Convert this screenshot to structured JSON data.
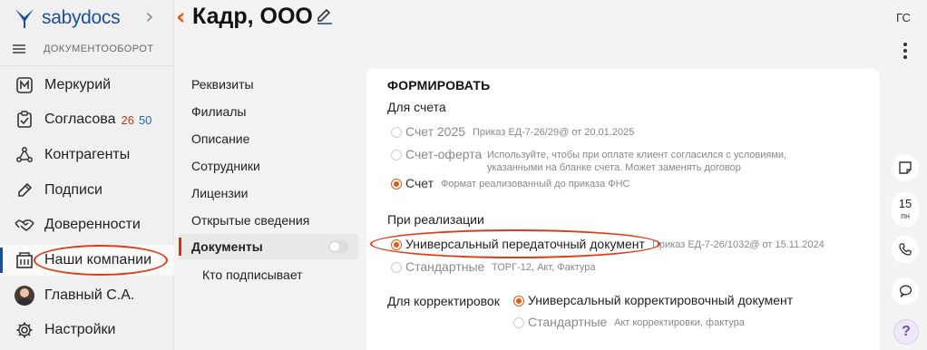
{
  "sidebar": {
    "brand": "sabydocs",
    "section": "ДОКУМЕНТООБОРОТ",
    "items": [
      {
        "label": "Меркурий",
        "icon": "mercury-m-icon"
      },
      {
        "label": "Согласова",
        "icon": "approval-clipboard-icon",
        "count_red": "26",
        "count_blue": "50"
      },
      {
        "label": "Контрагенты",
        "icon": "contractors-icon"
      },
      {
        "label": "Подписи",
        "icon": "signature-pen-icon"
      },
      {
        "label": "Доверенности",
        "icon": "handshake-icon"
      },
      {
        "label": "Наши компании",
        "icon": "building-icon"
      },
      {
        "label": "Главный С.А.",
        "icon": "user-avatar"
      },
      {
        "label": "Настройки",
        "icon": "gear-icon"
      }
    ],
    "active_index": 5
  },
  "header": {
    "title": "Кадр, ООО",
    "user_initials": "ГС"
  },
  "company_nav": {
    "items": [
      "Реквизиты",
      "Филиалы",
      "Описание",
      "Сотрудники",
      "Лицензии",
      "Открытые сведения",
      "Документы",
      "Кто подписывает"
    ],
    "active": "Документы"
  },
  "form": {
    "section_title": "ФОРМИРОВАТЬ",
    "invoice": {
      "label": "Для счета",
      "options": [
        {
          "label": "Счет 2025",
          "note": "Приказ ЕД-7-26/29@ от 20.01.2025",
          "selected": false
        },
        {
          "label": "Счет-оферта",
          "note_line1": "Используйте, чтобы при оплате клиент согласился с условиями,",
          "note_line2": "указанными на бланке счета. Может заменять договор",
          "selected": false
        },
        {
          "label": "Счет",
          "note": "Формат реализованный до приказа ФНС",
          "selected": true
        }
      ]
    },
    "sale": {
      "label": "При реализации",
      "options": [
        {
          "label": "Универсальный передаточный документ",
          "note": "Приказ ЕД-7-26/1032@ от 15.11.2024",
          "selected": true
        },
        {
          "label": "Стандартные",
          "note": "ТОРГ-12, Акт, Фактура",
          "selected": false
        }
      ]
    },
    "corrections": {
      "label": "Для корректировок",
      "options": [
        {
          "label": "Универсальный корректировочный документ",
          "selected": true
        },
        {
          "label": "Стандартные",
          "note": "Акт корректировки, фактура",
          "selected": false
        }
      ]
    }
  },
  "right_rail": {
    "date_day": "15",
    "date_weekday": "пн",
    "help": "?"
  },
  "colors": {
    "accent": "#e05a1c",
    "brand_blue": "#1f4e9a",
    "highlight_ring": "#e03a12"
  }
}
